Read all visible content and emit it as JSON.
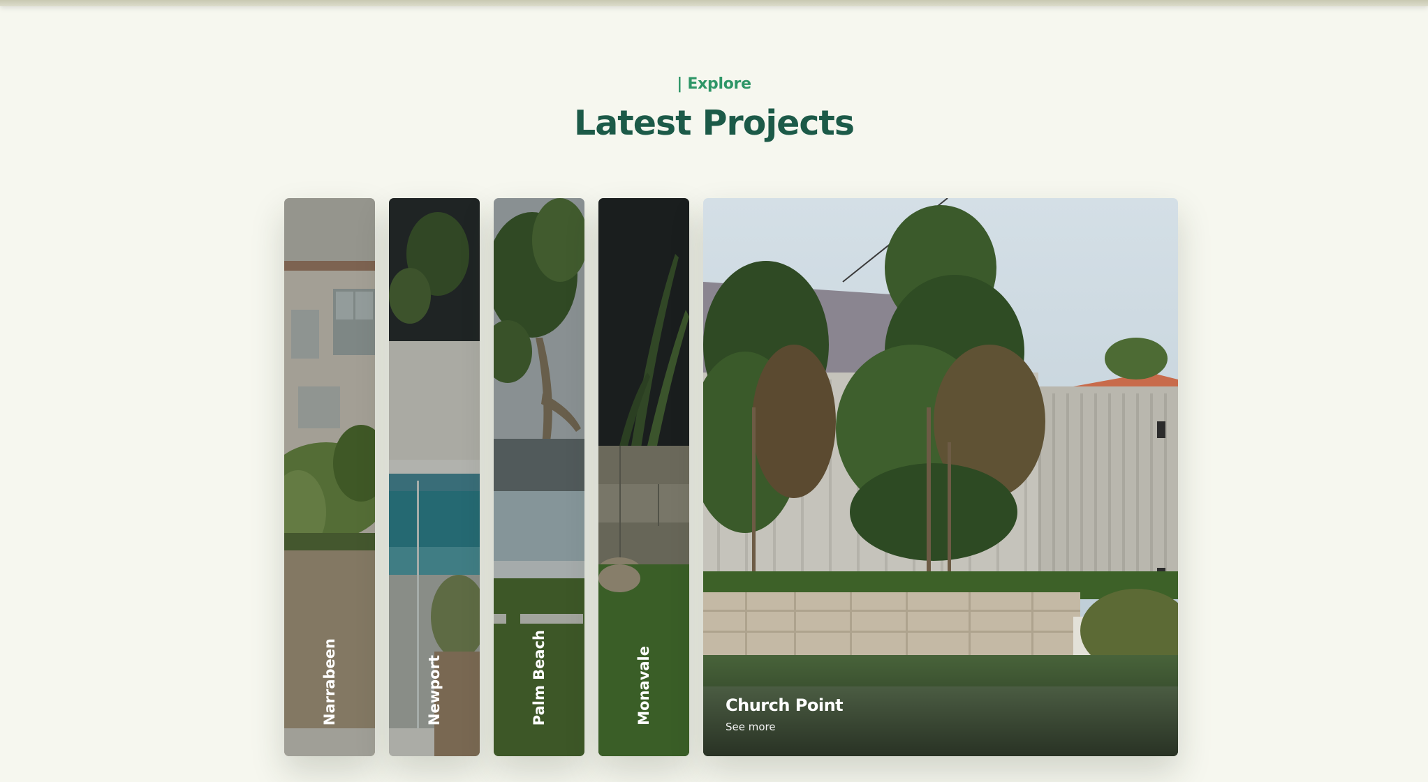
{
  "section": {
    "eyebrow": "| Explore",
    "title": "Latest Projects"
  },
  "projects": [
    {
      "name": "Narrabeen",
      "scene": "house-garden"
    },
    {
      "name": "Newport",
      "scene": "pool"
    },
    {
      "name": "Palm Beach",
      "scene": "frangipani-lawn"
    },
    {
      "name": "Monavale",
      "scene": "stone-wall"
    },
    {
      "name": "Church Point",
      "scene": "magnolia-fence",
      "link": "See more"
    }
  ],
  "colors": {
    "background": "#f6f7ef",
    "accent": "#2e9667",
    "heading": "#1c5a48"
  }
}
